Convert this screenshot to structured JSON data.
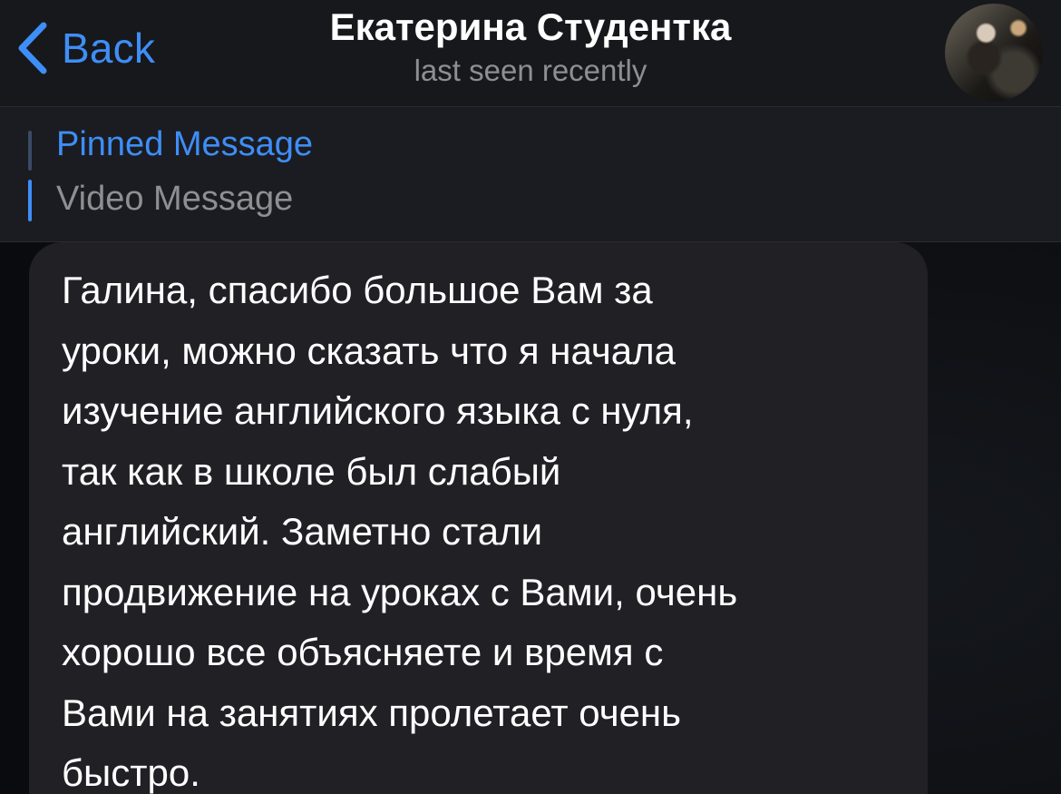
{
  "header": {
    "back_label": "Back",
    "contact_name": "Екатерина Студентка",
    "status": "last seen recently",
    "avatar_icon": "contact-avatar-photo"
  },
  "pinned": {
    "title": "Pinned Message",
    "preview": "Video Message"
  },
  "message": {
    "lines": [
      "Галина, спасибо большое Вам за",
      "уроки, можно сказать что я начала",
      "изучение английского языка с нуля,",
      "так как в школе был слабый",
      "английский. Заметно стали",
      "продвижение на уроках с Вами, очень",
      "хорошо все объясняете и время с",
      "Вами на занятиях пролетает очень",
      "быстро."
    ]
  },
  "colors": {
    "accent": "#3e8ef7",
    "header_bg": "#17181c",
    "bubble_bg": "#212125",
    "muted_text": "#8e8e93"
  }
}
